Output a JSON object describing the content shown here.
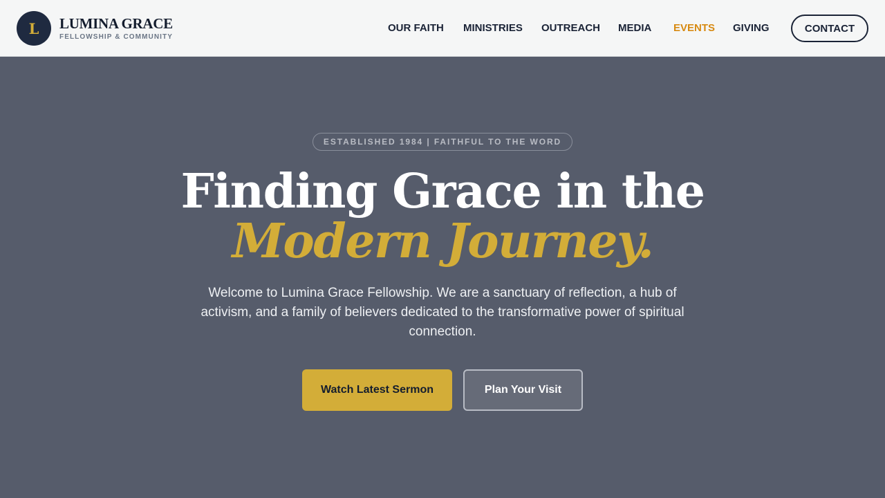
{
  "brand": {
    "mark": "L",
    "name": "LUMINA GRACE",
    "tagline": "FELLOWSHIP & COMMUNITY"
  },
  "nav": {
    "items": [
      {
        "label": "OUR FAITH",
        "active": false
      },
      {
        "label": "MINISTRIES",
        "active": false
      },
      {
        "label": "OUTREACH",
        "active": false
      },
      {
        "label": "MEDIA",
        "active": false
      },
      {
        "label": "EVENTS",
        "active": true
      },
      {
        "label": "GIVING",
        "active": false
      }
    ],
    "contact_label": "CONTACT"
  },
  "hero": {
    "badge": "ESTABLISHED 1984 | FAITHFUL TO THE WORD",
    "headline_line1": "Finding Grace in the",
    "headline_line2": "Modern Journey.",
    "intro": "Welcome to Lumina Grace Fellowship. We are a sanctuary of reflection, a hub of activism, and a family of believers dedicated to the transformative power of spiritual connection.",
    "primary_cta": "Watch Latest Sermon",
    "secondary_cta": "Plan Your Visit"
  },
  "colors": {
    "navy": "#1f2a40",
    "gold": "#d3ad38",
    "active_nav": "#d78a12",
    "hero_bg": "#565c6b",
    "header_bg": "#f5f6f6"
  }
}
